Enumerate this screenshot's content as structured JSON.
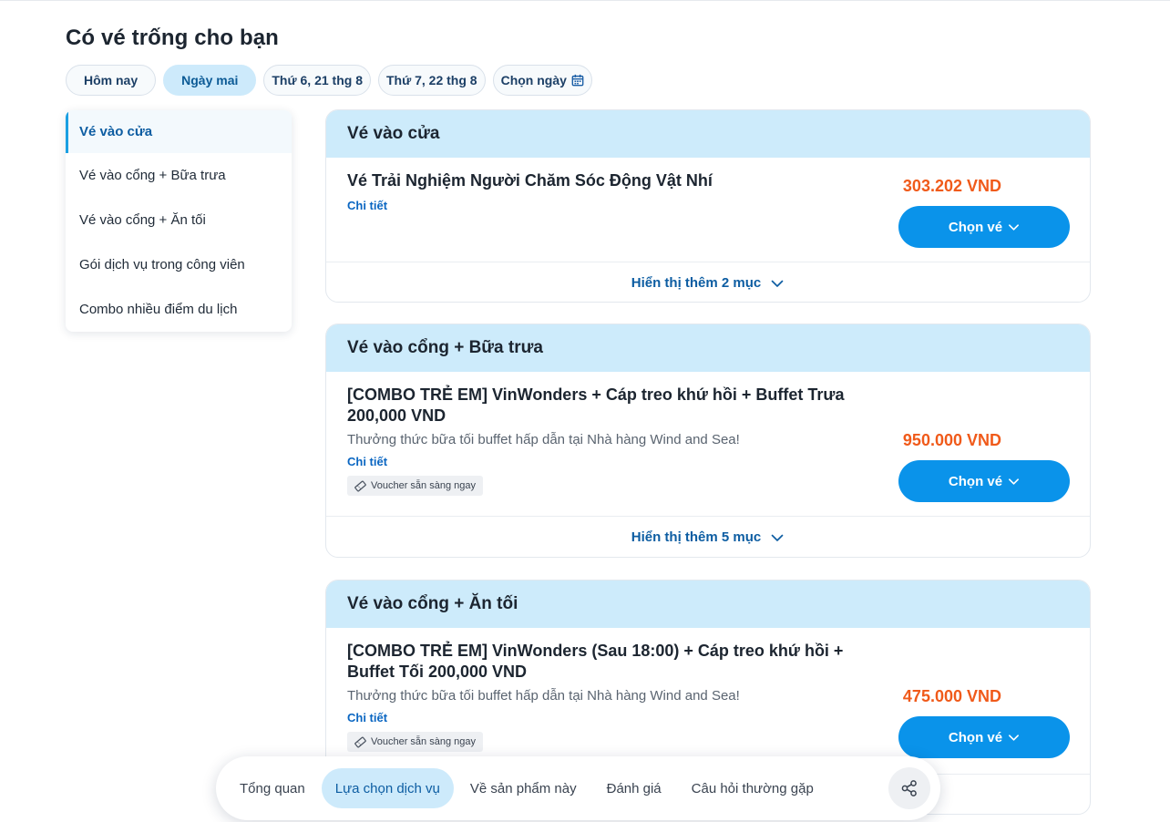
{
  "page": {
    "title": "Có vé trống cho bạn"
  },
  "date_chips": [
    {
      "label": "Hôm nay",
      "active": false
    },
    {
      "label": "Ngày mai",
      "active": true
    },
    {
      "label": "Thứ 6, 21 thg 8",
      "active": false
    },
    {
      "label": "Thứ 7, 22 thg 8",
      "active": false
    },
    {
      "label": "Chọn ngày",
      "active": false,
      "icon": "calendar-icon"
    }
  ],
  "sidebar": {
    "items": [
      {
        "label": "Vé vào cửa",
        "active": true
      },
      {
        "label": "Vé vào cổng + Bữa trưa"
      },
      {
        "label": "Vé vào cổng + Ăn tối"
      },
      {
        "label": "Gói dịch vụ trong công viên"
      },
      {
        "label": "Combo nhiều điểm du lịch"
      }
    ]
  },
  "sections": [
    {
      "title": "Vé vào cửa",
      "item": {
        "name": "Vé Trải Nghiệm Người Chăm Sóc Động Vật Nhí",
        "detail_link": "Chi tiết",
        "price": "303.202 VND",
        "button_label": "Chọn vé"
      },
      "show_more": "Hiển thị thêm 2 mục"
    },
    {
      "title": "Vé vào cổng + Bữa trưa",
      "item": {
        "name": "[COMBO TRẺ EM] VinWonders + Cáp treo khứ hồi + Buffet Trưa 200,000 VND",
        "description": "Thưởng thức bữa tối buffet hấp dẫn tại Nhà hàng Wind and Sea!",
        "detail_link": "Chi tiết",
        "voucher": "Voucher sẵn sàng ngay",
        "price": "950.000 VND",
        "button_label": "Chọn vé"
      },
      "show_more": "Hiển thị thêm 5 mục"
    },
    {
      "title": "Vé vào cổng + Ăn tối",
      "item": {
        "name": "[COMBO TRẺ EM] VinWonders (Sau 18:00) + Cáp treo khứ hồi + Buffet Tối 200,000 VND",
        "description": "Thưởng thức bữa tối buffet hấp dẫn tại Nhà hàng Wind and Sea!",
        "detail_link": "Chi tiết",
        "voucher": "Voucher sẵn sàng ngay",
        "price": "475.000 VND",
        "button_label": "Chọn vé"
      }
    }
  ],
  "bottom_nav": {
    "tabs": [
      {
        "label": "Tổng quan"
      },
      {
        "label": "Lựa chọn dịch vụ",
        "active": true
      },
      {
        "label": "Về sản phẩm này"
      },
      {
        "label": "Đánh giá"
      },
      {
        "label": "Câu hỏi thường gặp"
      }
    ],
    "share_icon": "share-icon"
  },
  "colors": {
    "accent": "#0a93ea",
    "section_header_bg": "#cdebfb",
    "price": "#f05a1a",
    "link": "#0a66c2"
  }
}
